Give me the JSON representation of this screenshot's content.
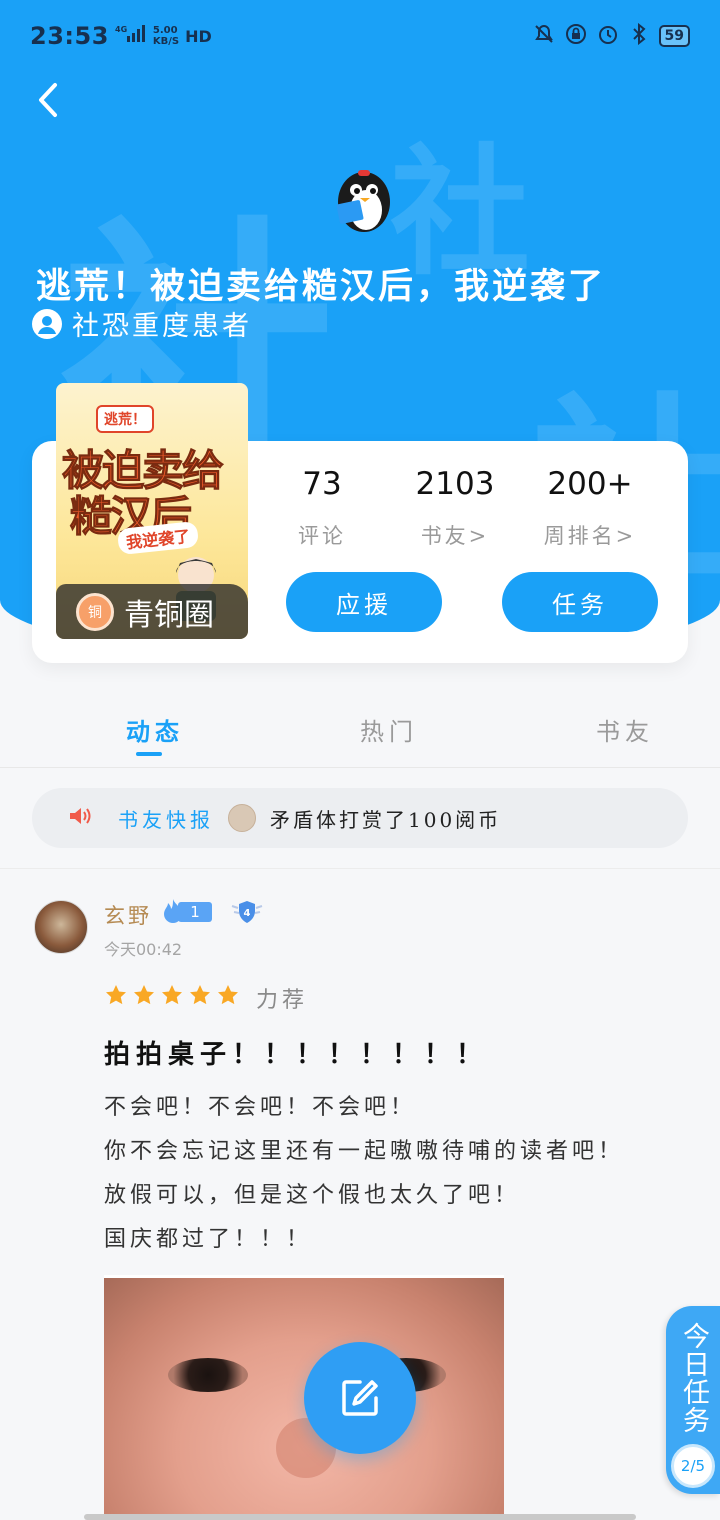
{
  "status_bar": {
    "time": "23:53",
    "network_speed": "5.00",
    "network_unit": "KB/S",
    "hd": "HD",
    "battery": "59"
  },
  "header": {
    "book_title": "逃荒！被迫卖给糙汉后，我逆袭了",
    "author": "社恐重度患者",
    "watermark_char": "社"
  },
  "cover": {
    "tag": "逃荒！",
    "line1": "被迫卖给",
    "line2": "糙汉后",
    "sub": "我逆袭了"
  },
  "tier": {
    "icon_text": "铜",
    "label": "青铜圈"
  },
  "stats": [
    {
      "value": "73",
      "label": "评论"
    },
    {
      "value": "2103",
      "label": "书友>"
    },
    {
      "value": "200+",
      "label": "周排名>"
    }
  ],
  "actions": {
    "support": "应援",
    "tasks": "任务"
  },
  "tabs": [
    {
      "label": "动态",
      "active": true
    },
    {
      "label": "热门",
      "active": false
    },
    {
      "label": "书友",
      "active": false
    }
  ],
  "news": {
    "label": "书友快报",
    "text": "矛盾体打赏了100阅币"
  },
  "post": {
    "username": "玄野",
    "level": "1",
    "badge_level": "4",
    "time": "今天00:42",
    "rating_label": "力荐",
    "stars": 5,
    "title": "拍拍桌子！！！！！！！！",
    "lines": [
      "不会吧！不会吧！不会吧！",
      "你不会忘记这里还有一起嗷嗷待哺的读者吧！",
      "放假可以，但是这个假也太久了吧！",
      "国庆都过了！！！"
    ]
  },
  "daily_task": {
    "label": "今日任务",
    "progress": "2/5"
  },
  "colors": {
    "primary": "#1aa1f7",
    "username": "#b58a52",
    "star": "#f9a825"
  }
}
